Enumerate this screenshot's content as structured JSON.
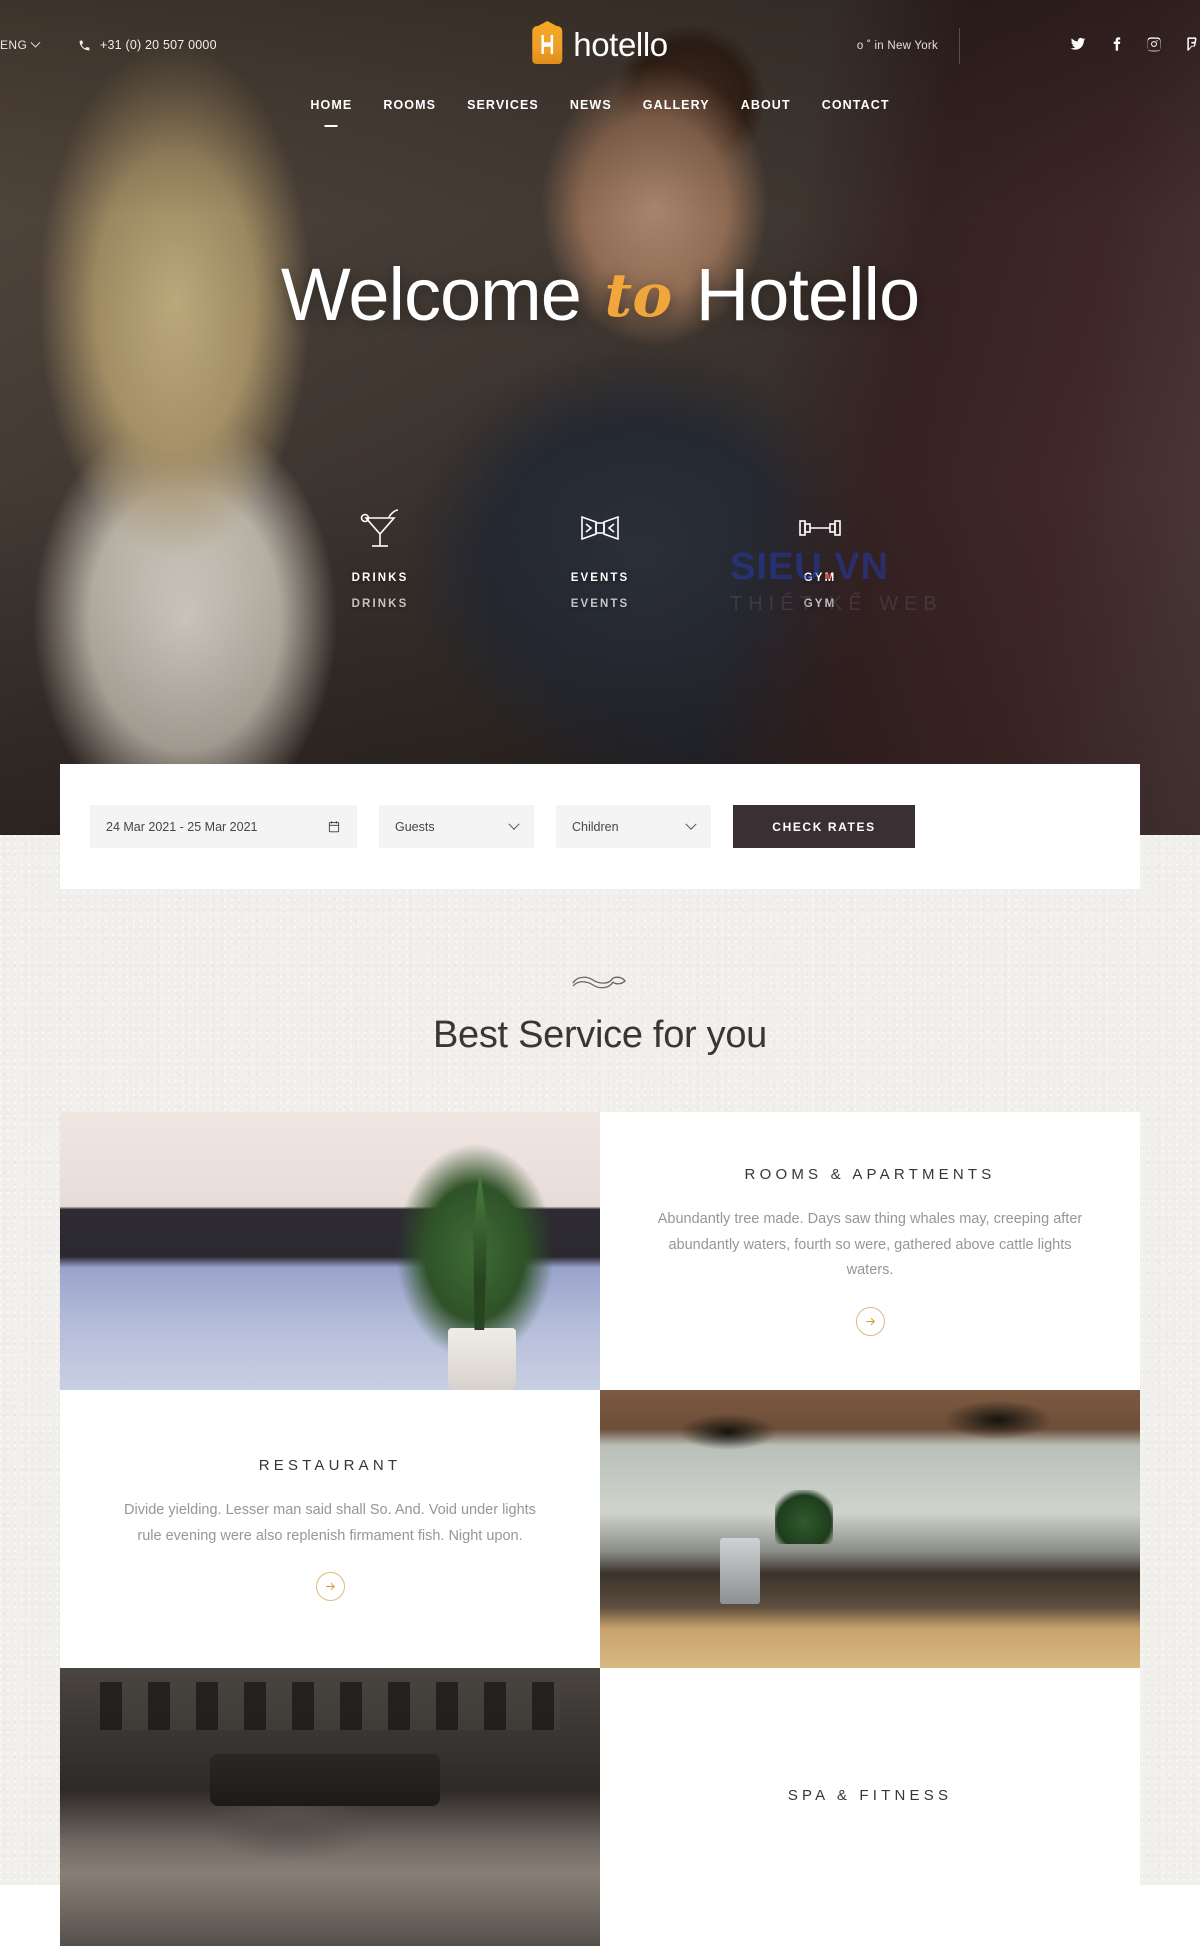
{
  "topbar": {
    "language": "ENG",
    "phone": "+31 (0) 20 507 0000",
    "brand_name": "hotello",
    "weather": "o ˚ in New York",
    "socials": [
      {
        "name": "twitter-icon",
        "label": "Twitter"
      },
      {
        "name": "facebook-icon",
        "label": "Facebook"
      },
      {
        "name": "instagram-icon",
        "label": "Instagram"
      },
      {
        "name": "foursquare-icon",
        "label": "Foursquare"
      }
    ]
  },
  "nav": {
    "items": [
      {
        "label": "HOME",
        "active": true
      },
      {
        "label": "ROOMS",
        "active": false
      },
      {
        "label": "SERVICES",
        "active": false
      },
      {
        "label": "NEWS",
        "active": false
      },
      {
        "label": "GALLERY",
        "active": false
      },
      {
        "label": "ABOUT",
        "active": false
      },
      {
        "label": "CONTACT",
        "active": false
      }
    ]
  },
  "hero": {
    "title_part1": "Welcome",
    "title_accent": "to",
    "title_part2": "Hotello",
    "features": [
      {
        "label": "DRINKS",
        "icon": "cocktail-icon"
      },
      {
        "label": "EVENTS",
        "icon": "bowtie-icon"
      },
      {
        "label": "GYM",
        "icon": "dumbbell-icon"
      }
    ]
  },
  "watermark": {
    "main": "SIEU",
    "dot": ".",
    "vn": "VN",
    "sub": "THIẾT KẾ WEB"
  },
  "booking": {
    "date_range": "24 Mar 2021 - 25 Mar 2021",
    "date_icon": "calendar-icon",
    "guests_label": "Guests",
    "children_label": "Children",
    "submit_label": "CHECK RATES"
  },
  "services": {
    "ornament_icon": "flourish-ornament",
    "heading": "Best Service for you",
    "cards": [
      {
        "title": "ROOMS & APARTMENTS",
        "text": "Abundantly tree made. Days saw thing whales may, creeping after abundantly waters, fourth so were, gathered above cattle lights waters.",
        "arrow_icon": "arrow-right-icon",
        "image": "hotel-bedroom-photo",
        "image_side": "left"
      },
      {
        "title": "RESTAURANT",
        "text": "Divide yielding. Lesser man said shall So. And. Void under lights rule evening were also replenish firmament fish. Night upon.",
        "arrow_icon": "arrow-right-icon",
        "image": "restaurant-interior-photo",
        "image_side": "right"
      },
      {
        "title": "SPA & FITNESS",
        "text": "",
        "arrow_icon": "arrow-right-icon",
        "image": "gym-workout-photo",
        "image_side": "left"
      }
    ]
  },
  "colors": {
    "accent_gold": "#f0a63a",
    "arrow_gold": "#d9952f",
    "button_dark": "#3a3033",
    "section_bg": "#f0efec"
  }
}
